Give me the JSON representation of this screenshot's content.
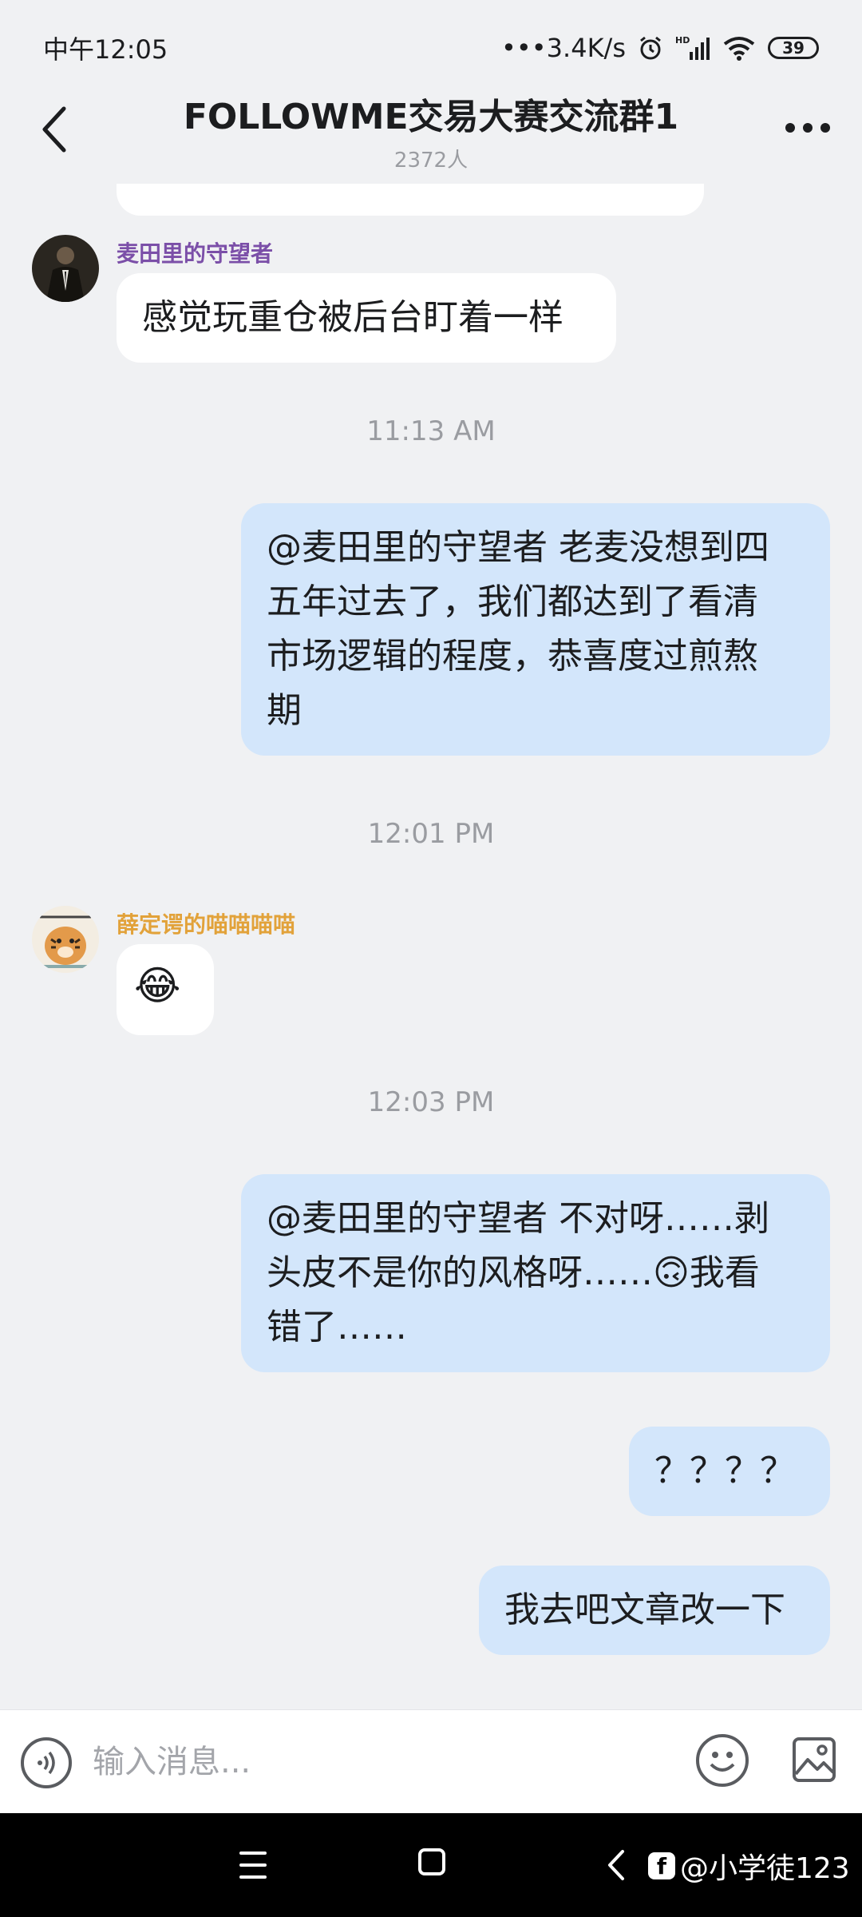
{
  "status_bar": {
    "time": "中午12:05",
    "net_speed": "•••3.4K/s",
    "hd_label": "HD",
    "battery": "39"
  },
  "header": {
    "title": "FOLLOWME交易大赛交流群1",
    "member_count": "2372人"
  },
  "messages": {
    "m1": {
      "sender": "麦田里的守望者",
      "sender_color": "#7b4fa8",
      "text": "感觉玩重仓被后台盯着一样"
    },
    "t1": "11:13 AM",
    "m2": {
      "lines": [
        "@麦田里的守望者 老麦没想到四",
        "五年过去了，我们都达到了看清",
        "市场逻辑的程度，恭喜度过煎熬",
        "期"
      ]
    },
    "t2": "12:01 PM",
    "m3": {
      "sender": "薛定谔的喵喵喵喵",
      "sender_color": "#e2a23a",
      "text": "😂"
    },
    "t3": "12:03 PM",
    "m4": {
      "lines": [
        "@麦田里的守望者 不对呀……剥",
        "头皮不是你的风格呀……🙃我看",
        "错了……"
      ]
    },
    "m5": {
      "text": "？？？？"
    },
    "m6": {
      "text": "我去吧文章改一下"
    }
  },
  "input_bar": {
    "placeholder": "输入消息..."
  },
  "nav_bar": {
    "watermark": "@小学徒123"
  },
  "colors": {
    "background": "#f0f1f3",
    "incoming_bubble": "#ffffff",
    "outgoing_bubble": "#d3e6fb"
  },
  "icons": [
    "back-icon",
    "more-icon",
    "alarm-icon",
    "signal-icon",
    "wifi-icon",
    "battery-icon",
    "voice-icon",
    "emoji-icon",
    "image-icon",
    "menu-icon",
    "home-icon",
    "nav-back-icon"
  ]
}
